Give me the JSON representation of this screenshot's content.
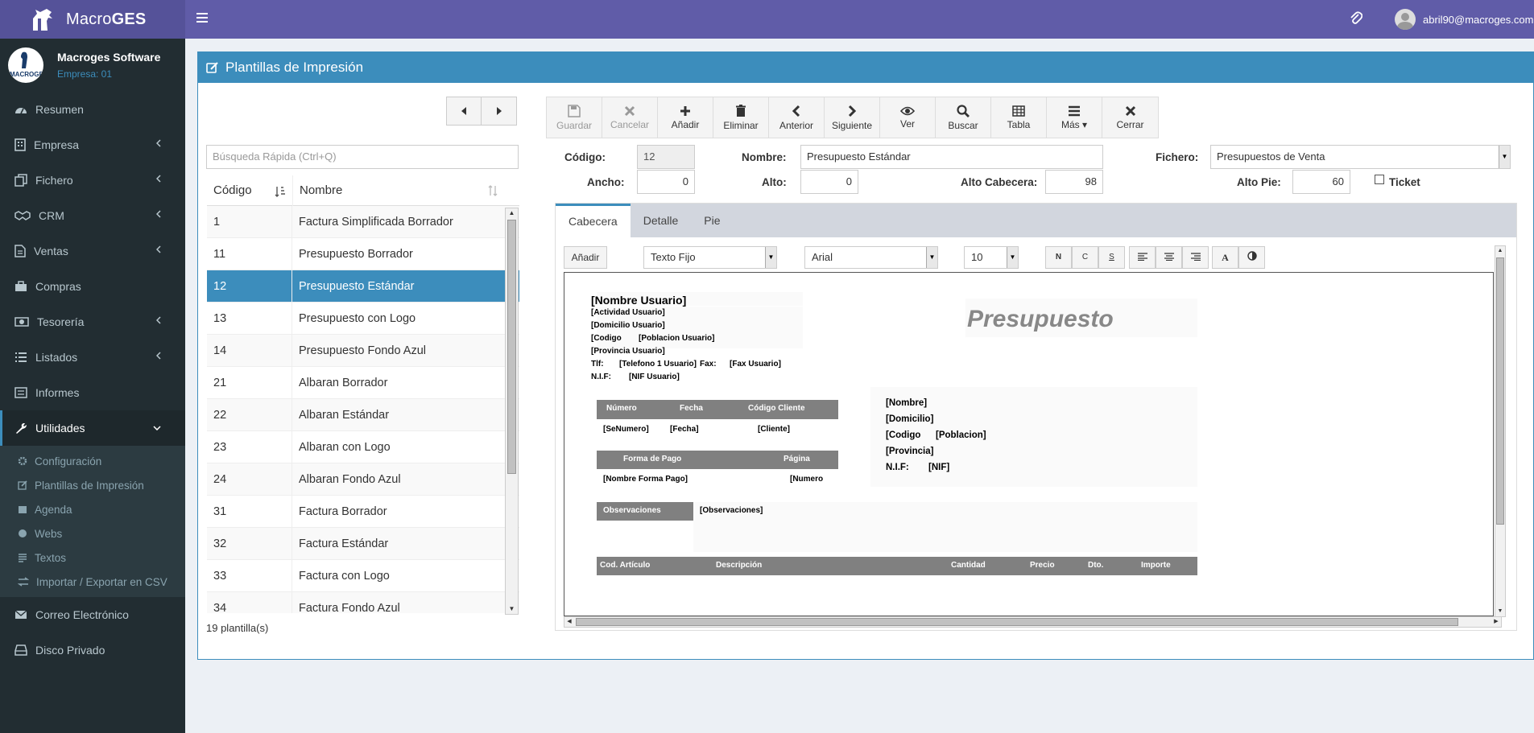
{
  "app": {
    "brand_regular": "Macro",
    "brand_bold": "GES",
    "user_email": "abril90@macroges.com"
  },
  "sidebar": {
    "company_name": "Macroges Software",
    "company_sub": "Empresa: 01",
    "logo_text": "MACROGES",
    "items": [
      {
        "label": "Resumen",
        "icon": "dashboard-icon"
      },
      {
        "label": "Empresa",
        "icon": "building-icon"
      },
      {
        "label": "Fichero",
        "icon": "files-icon"
      },
      {
        "label": "CRM",
        "icon": "handshake-icon"
      },
      {
        "label": "Ventas",
        "icon": "document-icon"
      },
      {
        "label": "Compras",
        "icon": "briefcase-icon"
      },
      {
        "label": "Tesorería",
        "icon": "money-icon"
      },
      {
        "label": "Listados",
        "icon": "list-icon"
      },
      {
        "label": "Informes",
        "icon": "report-icon"
      },
      {
        "label": "Utilidades",
        "icon": "wrench-icon"
      },
      {
        "label": "Correo Electrónico",
        "icon": "envelope-icon"
      },
      {
        "label": "Disco Privado",
        "icon": "hdd-icon"
      }
    ],
    "sub_items": [
      {
        "label": "Configuración",
        "icon": "gear-icon"
      },
      {
        "label": "Plantillas de Impresión",
        "icon": "edit-icon"
      },
      {
        "label": "Agenda",
        "icon": "calendar-icon"
      },
      {
        "label": "Webs",
        "icon": "globe-icon"
      },
      {
        "label": "Textos",
        "icon": "text-icon"
      },
      {
        "label": "Importar / Exportar en CSV",
        "icon": "exchange-icon"
      }
    ]
  },
  "page": {
    "title": "Plantillas de Impresión"
  },
  "list": {
    "search_placeholder": "Búsqueda Rápida (Ctrl+Q)",
    "col_code": "Código",
    "col_name": "Nombre",
    "rows": [
      {
        "code": "1",
        "name": "Factura Simplificada Borrador"
      },
      {
        "code": "11",
        "name": "Presupuesto Borrador"
      },
      {
        "code": "12",
        "name": "Presupuesto Estándar",
        "selected": true
      },
      {
        "code": "13",
        "name": "Presupuesto con Logo"
      },
      {
        "code": "14",
        "name": "Presupuesto Fondo Azul"
      },
      {
        "code": "21",
        "name": "Albaran Borrador"
      },
      {
        "code": "22",
        "name": "Albaran Estándar"
      },
      {
        "code": "23",
        "name": "Albaran con Logo"
      },
      {
        "code": "24",
        "name": "Albaran Fondo Azul"
      },
      {
        "code": "31",
        "name": "Factura Borrador"
      },
      {
        "code": "32",
        "name": "Factura Estándar"
      },
      {
        "code": "33",
        "name": "Factura con Logo"
      },
      {
        "code": "34",
        "name": "Factura Fondo Azul"
      }
    ],
    "count": "19 plantilla(s)"
  },
  "toolbar": {
    "guardar": "Guardar",
    "cancelar": "Cancelar",
    "anadir": "Añadir",
    "eliminar": "Eliminar",
    "anterior": "Anterior",
    "siguiente": "Siguiente",
    "ver": "Ver",
    "buscar": "Buscar",
    "tabla": "Tabla",
    "mas": "Más",
    "cerrar": "Cerrar"
  },
  "form": {
    "codigo_label": "Código:",
    "codigo_value": "12",
    "nombre_label": "Nombre:",
    "nombre_value": "Presupuesto Estándar",
    "fichero_label": "Fichero:",
    "fichero_value": "Presupuestos de Venta",
    "ancho_label": "Ancho:",
    "ancho_value": "0",
    "alto_label": "Alto:",
    "alto_value": "0",
    "alto_cab_label": "Alto Cabecera:",
    "alto_cab_value": "98",
    "alto_pie_label": "Alto Pie:",
    "alto_pie_value": "60",
    "ticket_label": "Ticket"
  },
  "tabs": [
    "Cabecera",
    "Detalle",
    "Pie"
  ],
  "editor": {
    "add_label": "Añadir",
    "type_value": "Texto Fijo",
    "font_value": "Arial",
    "size_value": "10",
    "bold": "N",
    "italic": "C",
    "underline": "S",
    "color_a": "A"
  },
  "canvas": {
    "nombre_usuario": "[Nombre Usuario]",
    "actividad": "[Actividad Usuario]",
    "domicilio_u": "[Domicilio Usuario]",
    "codigo_u": "[Codigo",
    "poblacion_u": "[Poblacion Usuario]",
    "provincia_u": "[Provincia Usuario]",
    "tlf": "Tlf:",
    "telefono": "[Telefono 1 Usuario]",
    "fax": "Fax:",
    "fax_u": "[Fax Usuario]",
    "nif_label": "N.I.F:",
    "nif_u": "[NIF Usuario]",
    "presupuesto": "Presupuesto",
    "h_numero": "Número",
    "h_fecha": "Fecha",
    "h_codcliente": "Código Cliente",
    "v_numero": "[SeNumero]",
    "v_fecha": "[Fecha]",
    "v_cliente": "[Cliente]",
    "h_forma": "Forma de Pago",
    "h_pagina": "Página",
    "v_forma": "[Nombre Forma Pago]",
    "v_pagina": "[Numero",
    "c_nombre": "[Nombre]",
    "c_domicilio": "[Domicilio]",
    "c_codigo": "[Codigo",
    "c_poblacion": "[Poblacion]",
    "c_provincia": "[Provincia]",
    "c_nif_label": "N.I.F:",
    "c_nif": "[NIF]",
    "obs_label": "Observaciones",
    "obs_value": "[Observaciones]",
    "d_cod": "Cod. Artículo",
    "d_desc": "Descripción",
    "d_cant": "Cantidad",
    "d_precio": "Precio",
    "d_dto": "Dto.",
    "d_importe": "Importe"
  }
}
